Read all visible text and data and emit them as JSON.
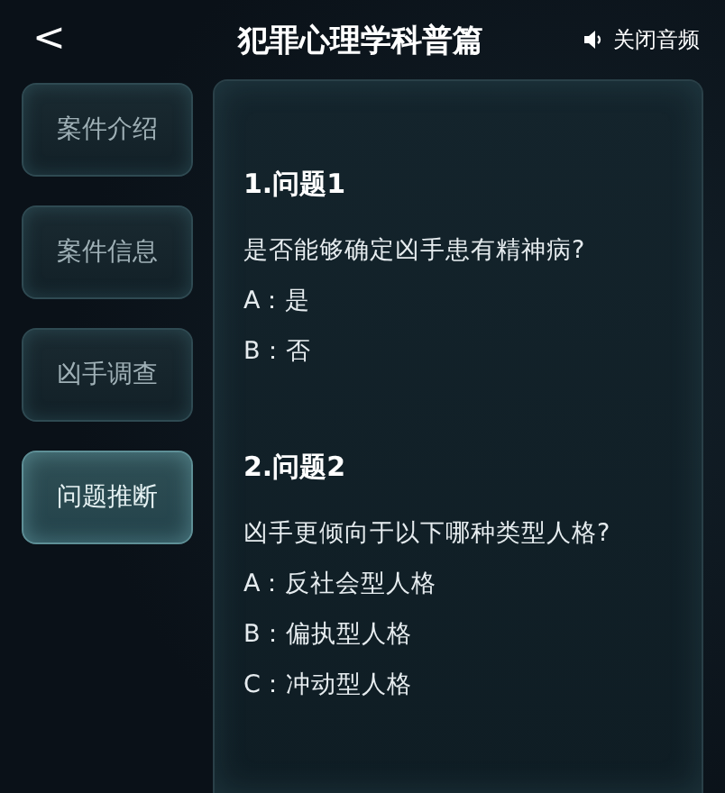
{
  "header": {
    "back_icon": "<",
    "title": "犯罪心理学科普篇",
    "audio_button": "关闭音频"
  },
  "sidebar": {
    "items": [
      {
        "label": "案件介绍",
        "selected": false
      },
      {
        "label": "案件信息",
        "selected": false
      },
      {
        "label": "凶手调查",
        "selected": false
      },
      {
        "label": "问题推断",
        "selected": true
      }
    ]
  },
  "questions": [
    {
      "title": "1.问题1",
      "text": "是否能够确定凶手患有精神病?",
      "options": [
        "A：是",
        "B：否"
      ]
    },
    {
      "title": "2.问题2",
      "text": "凶手更倾向于以下哪种类型人格?",
      "options": [
        "A：反社会型人格",
        "B：偏执型人格",
        "C：冲动型人格"
      ]
    }
  ]
}
